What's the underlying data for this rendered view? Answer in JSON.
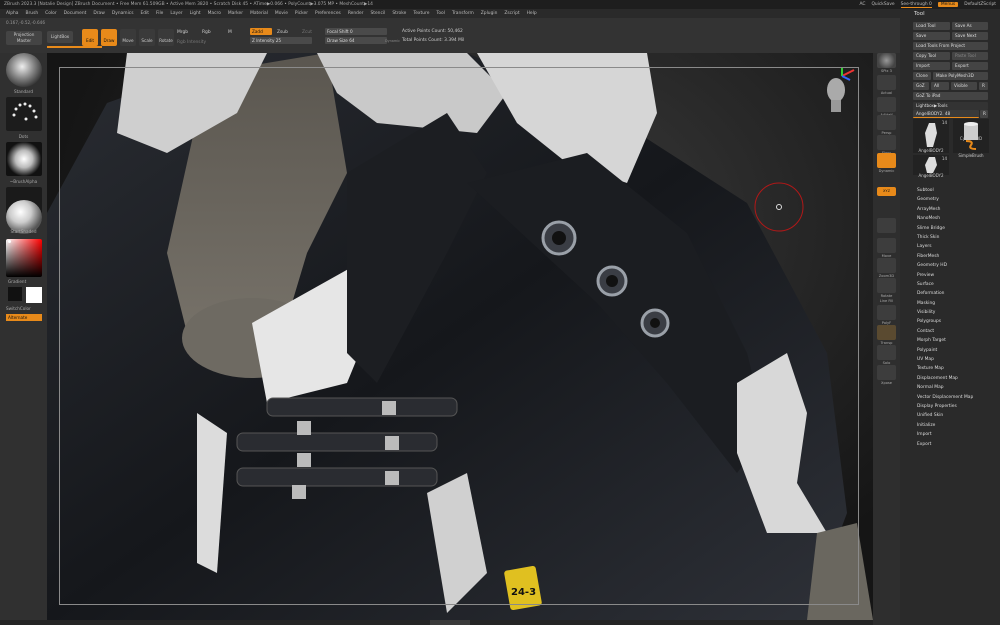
{
  "titlebar": {
    "title": "ZBrush 2023.3 [Natalie Design]   ZBrush Document   • Free Mem 61.509GB • Active Mem 3820 • Scratch Disk 45 • ATime▶0.066 • PolyCount▶3.075 MP • MeshCount▶14",
    "ac": "AC",
    "quicksave": "QuickSave",
    "seethrough": "See-through  0",
    "menus": "Menus",
    "script": "DefaultZScript"
  },
  "menu": [
    "Alpha",
    "Brush",
    "Color",
    "Document",
    "Draw",
    "Dynamics",
    "Edit",
    "File",
    "Layer",
    "Light",
    "Macro",
    "Marker",
    "Material",
    "Movie",
    "Picker",
    "Preferences",
    "Render",
    "Stencil",
    "Stroke",
    "Texture",
    "Tool",
    "Transform",
    "Zplugin",
    "Zscript",
    "Help"
  ],
  "coords": "0.167,-0.52,-0.646",
  "topbar": {
    "projection": "Projection Master",
    "lightbox": "LightBox",
    "edit": "Edit",
    "draw": "Draw",
    "move": "Move",
    "scale": "Scale",
    "rotate": "Rotate",
    "mrgb": "Mrgb",
    "rgb": "Rgb",
    "m": "M",
    "rgb_intensity": "Rgb Intensity",
    "zadd": "Zadd",
    "zsub": "Zsub",
    "zcut": "Zcut",
    "z_intensity": "Z Intensity 25",
    "focal_shift": "Focal Shift 0",
    "draw_size": "Draw Size 64",
    "dynamic": "Dynamic",
    "active_points": "Active Points Count: 50,462",
    "total_points": "Total Points Count: 3.394 Mil"
  },
  "left": {
    "standard": "Standard",
    "dots": "Dots",
    "brushalpha": "~BrushAlpha",
    "texture_off": "Texture Off",
    "startshaded": "StartShaded",
    "gradient": "Gradient",
    "switchcolor": "SwitchColor",
    "alternate": "Alternate"
  },
  "right": {
    "spix": "SPix 3",
    "actual": "Actual",
    "aahalf": "AAHalf",
    "persp": "Persp",
    "floor": "Floor",
    "dynamic": "Dynamic",
    "xyz": "XYZ",
    "move": "Move",
    "zoom3d": "Zoom3D",
    "rotate": "Rotate",
    "linefill": "Line Fill",
    "polyf": "PolyF",
    "transp": "Transp",
    "ghost": "Ghost",
    "solo": "Solo",
    "xpose": "Xpose"
  },
  "tool": {
    "header": "Tool",
    "load_tool": "Load Tool",
    "save_as": "Save As",
    "save": "Save",
    "save_next": "Save Next",
    "load_tools_from_project": "Load Tools From Project",
    "copy_tool": "Copy Tool",
    "paste_tool": "Paste Tool",
    "import": "Import",
    "export": "Export",
    "clone": "Clone",
    "make_polymesh3d": "Make PolyMesh3D",
    "goz": "GoZ",
    "all": "All",
    "visible": "Visible",
    "r": "R",
    "goz_ipad": "GoZ To iPad",
    "lightbox_tools": "Lightbox▶Tools",
    "current": "AngelBODY2. 48",
    "r2": "R",
    "thumb1": "AngelBODY2",
    "thumb2": "Cylinder3D",
    "thumb3": "SimpleBrush",
    "thumb4": "AngelBODY2",
    "n1": "14",
    "n2": "14",
    "sections": [
      "Subtool",
      "Geometry",
      "ArrayMesh",
      "NanoMesh",
      "Slime Bridge",
      "Thick Skin",
      "Layers",
      "FiberMesh",
      "Geometry HD",
      "Preview",
      "Surface",
      "Deformation",
      "Masking",
      "Visibility",
      "Polygroups",
      "Contact",
      "Morph Target",
      "Polypaint",
      "UV Map",
      "Texture Map",
      "Displacement Map",
      "Normal Map",
      "Vector Displacement Map",
      "Display Properties",
      "Unified Skin",
      "Initialize",
      "Import",
      "Export"
    ]
  },
  "colors": {
    "accent": "#e88a1a"
  },
  "canvas_text": {
    "badge": "24-3"
  }
}
